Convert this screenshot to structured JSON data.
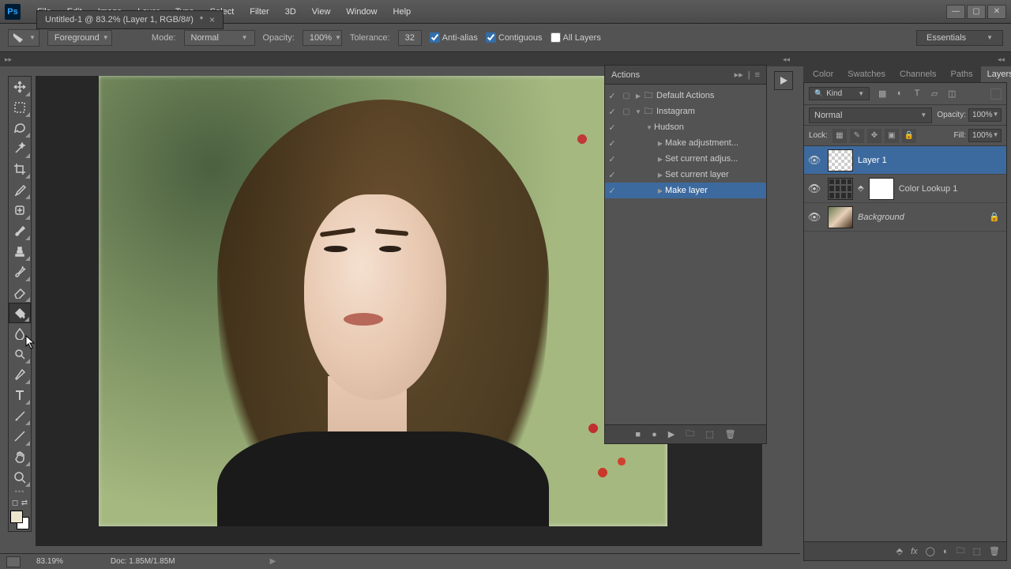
{
  "menu": [
    "File",
    "Edit",
    "Image",
    "Layer",
    "Type",
    "Select",
    "Filter",
    "3D",
    "View",
    "Window",
    "Help"
  ],
  "options_bar": {
    "fill_source": "Foreground",
    "mode_label": "Mode:",
    "mode_value": "Normal",
    "opacity_label": "Opacity:",
    "opacity_value": "100%",
    "tolerance_label": "Tolerance:",
    "tolerance_value": "32",
    "antialias": "Anti-alias",
    "contiguous": "Contiguous",
    "all_layers": "All Layers"
  },
  "workspace": "Essentials",
  "document_tab": {
    "title": "Untitled-1 @ 83.2% (Layer 1, RGB/8#)",
    "dirty": "*"
  },
  "tools": [
    "move",
    "marquee",
    "lasso",
    "wand",
    "crop",
    "eyedropper",
    "healing",
    "brush",
    "stamp",
    "history",
    "eraser",
    "bucket",
    "blur",
    "dodge",
    "pen",
    "type",
    "path",
    "shape",
    "hand",
    "zoom"
  ],
  "actions_panel": {
    "title": "Actions",
    "items": [
      {
        "indent": 0,
        "caret": "▶",
        "folder": true,
        "label": "Default Actions"
      },
      {
        "indent": 0,
        "caret": "▼",
        "folder": true,
        "label": "Instagram"
      },
      {
        "indent": 1,
        "caret": "▼",
        "folder": false,
        "label": "Hudson"
      },
      {
        "indent": 2,
        "caret": "▶",
        "folder": false,
        "label": "Make adjustment..."
      },
      {
        "indent": 2,
        "caret": "▶",
        "folder": false,
        "label": "Set current adjus..."
      },
      {
        "indent": 2,
        "caret": "▶",
        "folder": false,
        "label": "Set current layer"
      },
      {
        "indent": 2,
        "caret": "▶",
        "folder": false,
        "label": "Make layer",
        "selected": true
      }
    ]
  },
  "right_tabs": [
    "Color",
    "Swatches",
    "Channels",
    "Paths",
    "Layers"
  ],
  "layers_panel": {
    "kind_label": "Kind",
    "blend_mode": "Normal",
    "opacity_label": "Opacity:",
    "opacity_value": "100%",
    "lock_label": "Lock:",
    "fill_label": "Fill:",
    "fill_value": "100%",
    "layers": [
      {
        "name": "Layer 1",
        "thumb": "checker",
        "selected": true
      },
      {
        "name": "Color Lookup 1",
        "thumb": "grid",
        "mask": true,
        "link": true
      },
      {
        "name": "Background",
        "thumb": "img",
        "italic": true,
        "locked": true
      }
    ]
  },
  "status": {
    "zoom": "83.19%",
    "doc": "Doc: 1.85M/1.85M"
  }
}
